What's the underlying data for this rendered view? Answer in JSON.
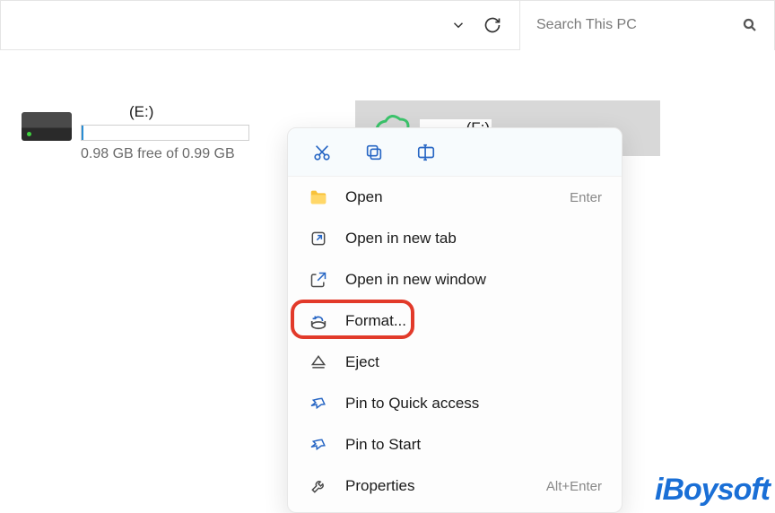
{
  "toolbar": {
    "search_placeholder": "Search This PC"
  },
  "drives": {
    "e": {
      "label": "(E:)",
      "status": "0.98 GB free of 0.99 GB"
    },
    "f": {
      "label": "(F:)"
    }
  },
  "context_menu": {
    "open": {
      "label": "Open",
      "shortcut": "Enter"
    },
    "open_tab": {
      "label": "Open in new tab"
    },
    "open_window": {
      "label": "Open in new window"
    },
    "format": {
      "label": "Format..."
    },
    "eject": {
      "label": "Eject"
    },
    "pin_quick": {
      "label": "Pin to Quick access"
    },
    "pin_start": {
      "label": "Pin to Start"
    },
    "properties": {
      "label": "Properties",
      "shortcut": "Alt+Enter"
    }
  },
  "watermark": "iBoysoft"
}
